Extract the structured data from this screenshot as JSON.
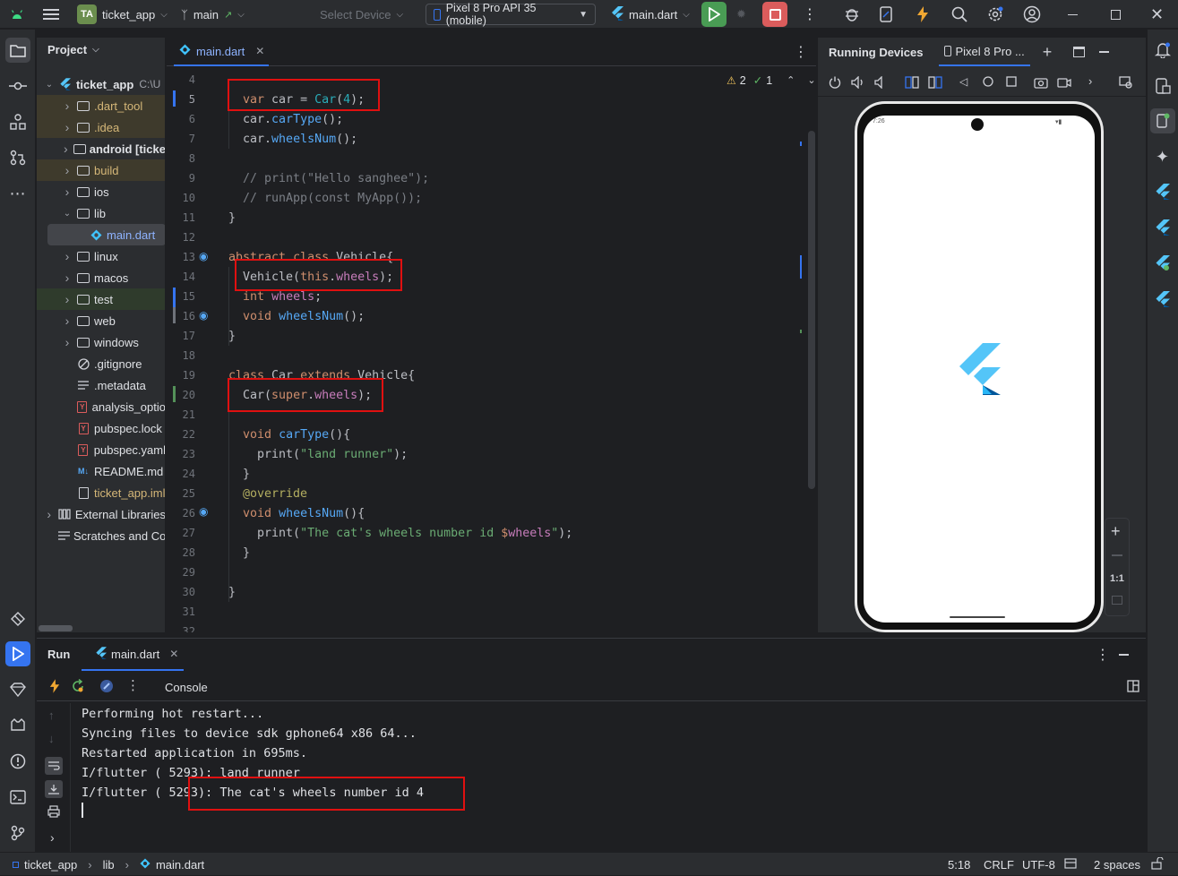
{
  "titlebar": {
    "project_badge": "TA",
    "project_name": "ticket_app",
    "branch": "main",
    "select_device": "Select Device",
    "device": "Pixel 8 Pro API 35 (mobile)",
    "run_config": "main.dart"
  },
  "project_panel": {
    "title": "Project",
    "root": "ticket_app",
    "root_path": "C:\\U",
    "items": [
      {
        "label": "ticket_app",
        "suffix": "C:\\U"
      },
      {
        "label": ".dart_tool"
      },
      {
        "label": ".idea"
      },
      {
        "label": "android [ticke"
      },
      {
        "label": "build"
      },
      {
        "label": "ios"
      },
      {
        "label": "lib"
      },
      {
        "label": "main.dart"
      },
      {
        "label": "linux"
      },
      {
        "label": "macos"
      },
      {
        "label": "test"
      },
      {
        "label": "web"
      },
      {
        "label": "windows"
      },
      {
        "label": ".gitignore"
      },
      {
        "label": ".metadata"
      },
      {
        "label": "analysis_optio"
      },
      {
        "label": "pubspec.lock"
      },
      {
        "label": "pubspec.yaml"
      },
      {
        "label": "README.md"
      },
      {
        "label": "ticket_app.iml"
      },
      {
        "label": "External Libraries"
      },
      {
        "label": "Scratches and Co"
      }
    ]
  },
  "editor": {
    "tab": "main.dart",
    "warnings": "2",
    "weak_warnings": "1",
    "line_numbers": [
      "4",
      "5",
      "6",
      "7",
      "8",
      "9",
      "10",
      "11",
      "12",
      "13",
      "14",
      "15",
      "16",
      "17",
      "18",
      "19",
      "20",
      "21",
      "22",
      "23",
      "24",
      "25",
      "26",
      "27",
      "28",
      "29",
      "30",
      "31",
      "32"
    ],
    "lines": [
      "",
      "  var car = Car(4);",
      "  car.carType();",
      "  car.wheelsNum();",
      "",
      "  // print(\"Hello sanghee\");",
      "  // runApp(const MyApp());",
      "}",
      "",
      "abstract class Vehicle{",
      "  Vehicle(this.wheels);",
      "  int wheels;",
      "  void wheelsNum();",
      "}",
      "",
      "class Car extends Vehicle{",
      "  Car(super.wheels);",
      "",
      "  void carType(){",
      "    print(\"land runner\");",
      "  }",
      "  @override",
      "  void wheelsNum(){",
      "    print(\"The cat's wheels number id $wheels\");",
      "  }",
      "",
      "}",
      "",
      ""
    ]
  },
  "devices": {
    "title": "Running Devices",
    "tab": "Pixel 8 Pro ...",
    "phone_status_time": "7:26",
    "zoom_label": "1:1"
  },
  "run_panel": {
    "title": "Run",
    "tab": "main.dart",
    "console_label": "Console",
    "output": [
      "Performing hot restart...",
      "Syncing files to device sdk gphone64 x86 64...",
      "Restarted application in 695ms.",
      "I/flutter ( 5293): land runner",
      "I/flutter ( 5293): The cat's wheels number id 4"
    ]
  },
  "statusbar": {
    "crumbs": [
      "ticket_app",
      "lib",
      "main.dart"
    ],
    "position": "5:18",
    "line_ending": "CRLF",
    "encoding": "UTF-8",
    "indent": "2 spaces"
  },
  "colors": {
    "accent": "#3574f0",
    "run_green": "#499c54",
    "stop_red": "#db5c5c",
    "highlight_red": "#e01010"
  }
}
